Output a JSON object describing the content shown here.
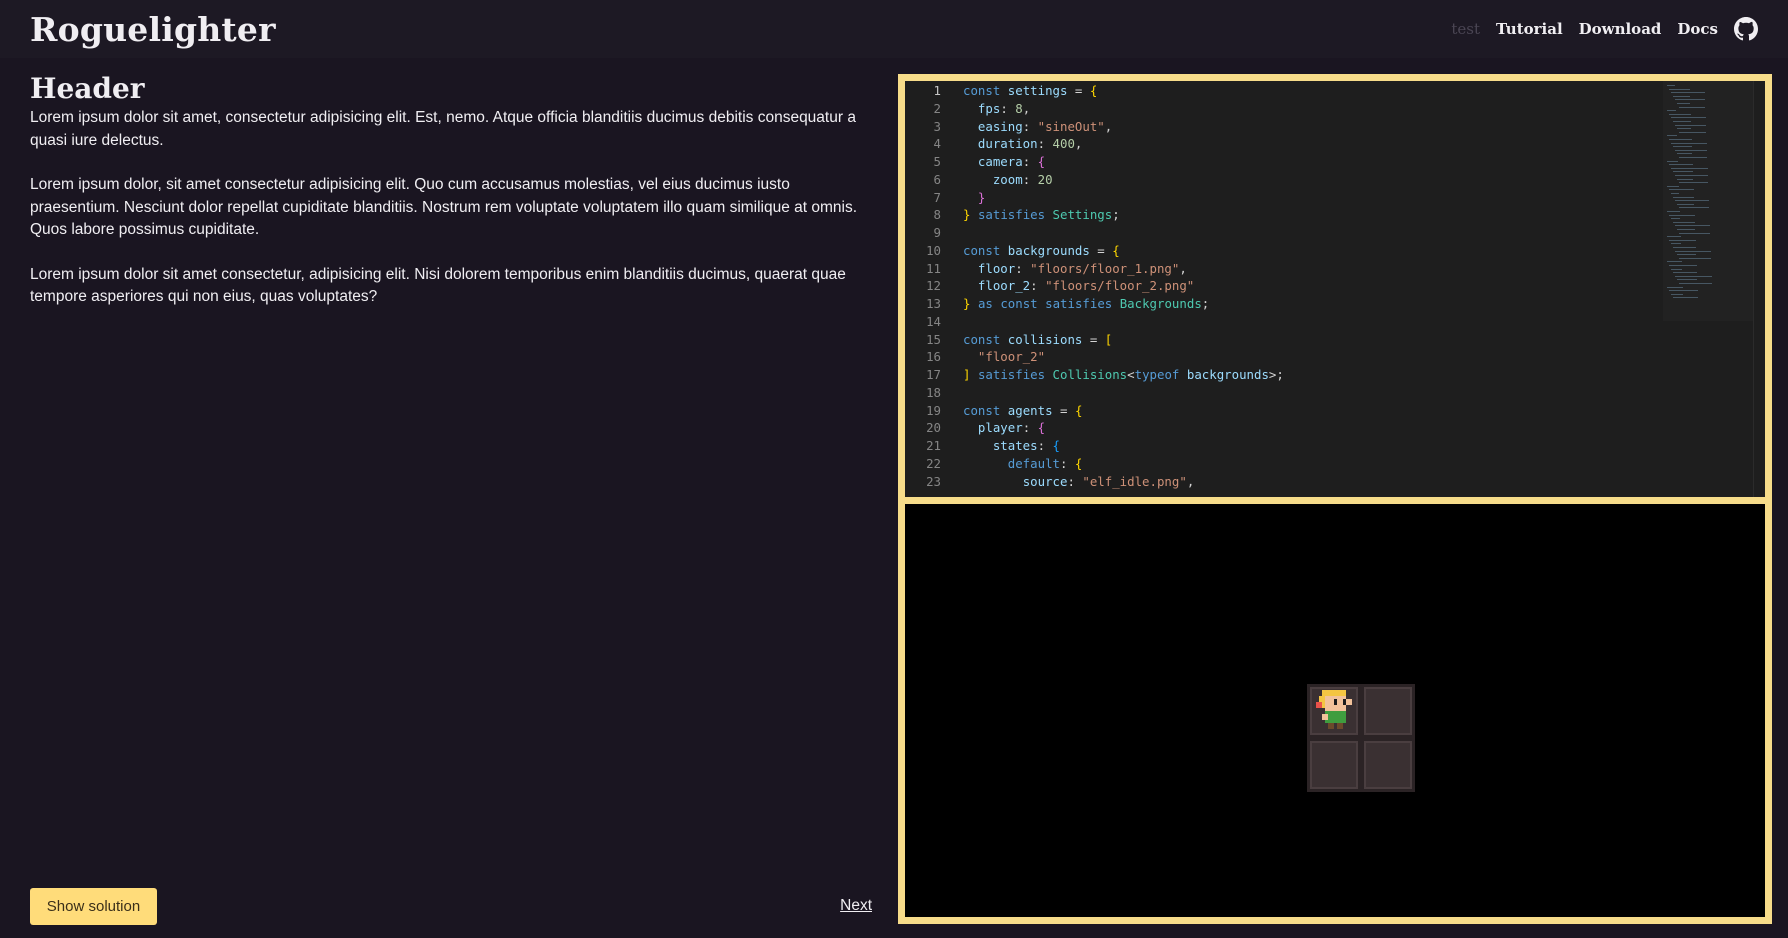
{
  "header": {
    "brand": "Roguelighter",
    "nav": {
      "test_label": "test",
      "tutorial_label": "Tutorial",
      "download_label": "Download",
      "docs_label": "Docs"
    },
    "github_icon": "github-icon"
  },
  "lesson": {
    "title": "Header",
    "paragraphs": [
      "Lorem ipsum dolor sit amet, consectetur adipisicing elit. Est, nemo. Atque officia blanditiis ducimus debitis consequatur a quasi iure delectus.",
      "Lorem ipsum dolor, sit amet consectetur adipisicing elit. Quo cum accusamus molestias, vel eius ducimus iusto praesentium. Nesciunt dolor repellat cupiditate blanditiis. Nostrum rem voluptate voluptatem illo quam similique at omnis. Quos labore possimus cupiditate.",
      "Lorem ipsum dolor sit amet consectetur, adipisicing elit. Nisi dolorem temporibus enim blanditiis ducimus, quaerat quae tempore asperiores qui non eius, quas voluptates?"
    ],
    "show_solution_label": "Show solution",
    "next_label": "Next"
  },
  "editor": {
    "active_line": 1,
    "lines": [
      [
        [
          "k",
          "const"
        ],
        [
          "p",
          " "
        ],
        [
          "v",
          "settings"
        ],
        [
          "p",
          " = "
        ],
        [
          "b1",
          "{"
        ]
      ],
      [
        [
          "p",
          "  "
        ],
        [
          "v",
          "fps"
        ],
        [
          "p",
          ": "
        ],
        [
          "n",
          "8"
        ],
        [
          "p",
          ","
        ]
      ],
      [
        [
          "p",
          "  "
        ],
        [
          "v",
          "easing"
        ],
        [
          "p",
          ": "
        ],
        [
          "s",
          "\"sineOut\""
        ],
        [
          "p",
          ","
        ]
      ],
      [
        [
          "p",
          "  "
        ],
        [
          "v",
          "duration"
        ],
        [
          "p",
          ": "
        ],
        [
          "n",
          "400"
        ],
        [
          "p",
          ","
        ]
      ],
      [
        [
          "p",
          "  "
        ],
        [
          "v",
          "camera"
        ],
        [
          "p",
          ": "
        ],
        [
          "b2",
          "{"
        ]
      ],
      [
        [
          "p",
          "    "
        ],
        [
          "v",
          "zoom"
        ],
        [
          "p",
          ": "
        ],
        [
          "n",
          "20"
        ]
      ],
      [
        [
          "p",
          "  "
        ],
        [
          "b2",
          "}"
        ]
      ],
      [
        [
          "b1",
          "}"
        ],
        [
          "p",
          " "
        ],
        [
          "k",
          "satisfies"
        ],
        [
          "p",
          " "
        ],
        [
          "t",
          "Settings"
        ],
        [
          "p",
          ";"
        ]
      ],
      [
        [
          "p",
          ""
        ]
      ],
      [
        [
          "k",
          "const"
        ],
        [
          "p",
          " "
        ],
        [
          "v",
          "backgrounds"
        ],
        [
          "p",
          " = "
        ],
        [
          "b1",
          "{"
        ]
      ],
      [
        [
          "p",
          "  "
        ],
        [
          "v",
          "floor"
        ],
        [
          "p",
          ": "
        ],
        [
          "s",
          "\"floors/floor_1.png\""
        ],
        [
          "p",
          ","
        ]
      ],
      [
        [
          "p",
          "  "
        ],
        [
          "v",
          "floor_2"
        ],
        [
          "p",
          ": "
        ],
        [
          "s",
          "\"floors/floor_2.png\""
        ]
      ],
      [
        [
          "b1",
          "}"
        ],
        [
          "p",
          " "
        ],
        [
          "k",
          "as"
        ],
        [
          "p",
          " "
        ],
        [
          "k",
          "const"
        ],
        [
          "p",
          " "
        ],
        [
          "k",
          "satisfies"
        ],
        [
          "p",
          " "
        ],
        [
          "t",
          "Backgrounds"
        ],
        [
          "p",
          ";"
        ]
      ],
      [
        [
          "p",
          ""
        ]
      ],
      [
        [
          "k",
          "const"
        ],
        [
          "p",
          " "
        ],
        [
          "v",
          "collisions"
        ],
        [
          "p",
          " = "
        ],
        [
          "b1",
          "["
        ]
      ],
      [
        [
          "p",
          "  "
        ],
        [
          "s",
          "\"floor_2\""
        ]
      ],
      [
        [
          "b1",
          "]"
        ],
        [
          "p",
          " "
        ],
        [
          "k",
          "satisfies"
        ],
        [
          "p",
          " "
        ],
        [
          "t",
          "Collisions"
        ],
        [
          "p",
          "<"
        ],
        [
          "k",
          "typeof"
        ],
        [
          "p",
          " "
        ],
        [
          "v",
          "backgrounds"
        ],
        [
          "p",
          ">;"
        ]
      ],
      [
        [
          "p",
          ""
        ]
      ],
      [
        [
          "k",
          "const"
        ],
        [
          "p",
          " "
        ],
        [
          "v",
          "agents"
        ],
        [
          "p",
          " = "
        ],
        [
          "b1",
          "{"
        ]
      ],
      [
        [
          "p",
          "  "
        ],
        [
          "v",
          "player"
        ],
        [
          "p",
          ": "
        ],
        [
          "b2",
          "{"
        ]
      ],
      [
        [
          "p",
          "    "
        ],
        [
          "v",
          "states"
        ],
        [
          "p",
          ": "
        ],
        [
          "b3",
          "{"
        ]
      ],
      [
        [
          "p",
          "      "
        ],
        [
          "k",
          "default"
        ],
        [
          "p",
          ": "
        ],
        [
          "b1",
          "{"
        ]
      ],
      [
        [
          "p",
          "        "
        ],
        [
          "v",
          "source"
        ],
        [
          "p",
          ": "
        ],
        [
          "s",
          "\"elf_idle.png\""
        ],
        [
          "p",
          ","
        ]
      ]
    ]
  },
  "game": {
    "sprite_icon": "elf-sprite-icon"
  }
}
